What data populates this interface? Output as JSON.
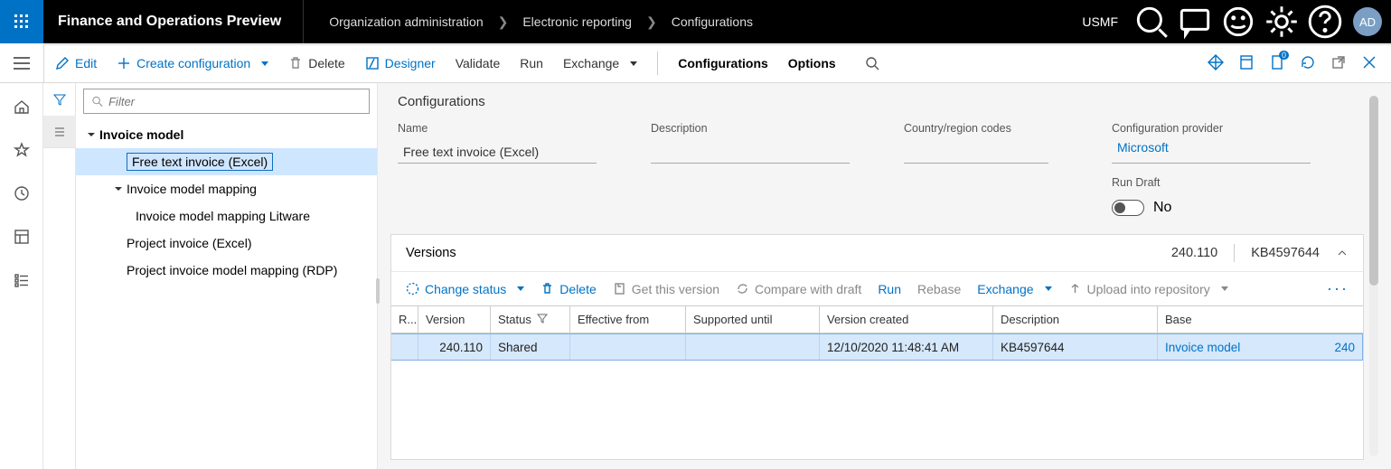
{
  "top": {
    "product": "Finance and Operations Preview",
    "breadcrumbs": [
      "Organization administration",
      "Electronic reporting",
      "Configurations"
    ],
    "company": "USMF",
    "avatar": "AD"
  },
  "cmd": {
    "edit": "Edit",
    "create": "Create configuration",
    "delete": "Delete",
    "designer": "Designer",
    "validate": "Validate",
    "run": "Run",
    "exchange": "Exchange",
    "configs": "Configurations",
    "options": "Options"
  },
  "tree": {
    "filter_placeholder": "Filter",
    "root": "Invoice model",
    "free_text": "Free text invoice (Excel)",
    "mapping": "Invoice model mapping",
    "mapping_litware": "Invoice model mapping Litware",
    "project_excel": "Project invoice (Excel)",
    "project_rdp": "Project invoice model mapping (RDP)"
  },
  "detail": {
    "title": "Configurations",
    "labels": {
      "name": "Name",
      "description": "Description",
      "country": "Country/region codes",
      "provider": "Configuration provider",
      "rundraft": "Run Draft"
    },
    "name_value": "Free text invoice (Excel)",
    "description_value": "",
    "country_value": "",
    "provider_value": "Microsoft",
    "rundraft_value": "No"
  },
  "versions": {
    "title": "Versions",
    "summary_ver": "240.110",
    "summary_kb": "KB4597644",
    "toolbar": {
      "change_status": "Change status",
      "delete": "Delete",
      "get": "Get this version",
      "compare": "Compare with draft",
      "run": "Run",
      "rebase": "Rebase",
      "exchange": "Exchange",
      "upload": "Upload into repository"
    },
    "columns": {
      "r": "R...",
      "version": "Version",
      "status": "Status",
      "effective": "Effective from",
      "supported": "Supported until",
      "created": "Version created",
      "description": "Description",
      "base": "Base"
    },
    "row": {
      "version": "240.110",
      "status": "Shared",
      "effective": "",
      "supported": "",
      "created": "12/10/2020 11:48:41 AM",
      "description": "KB4597644",
      "base_name": "Invoice model",
      "base_ver": "240"
    }
  }
}
